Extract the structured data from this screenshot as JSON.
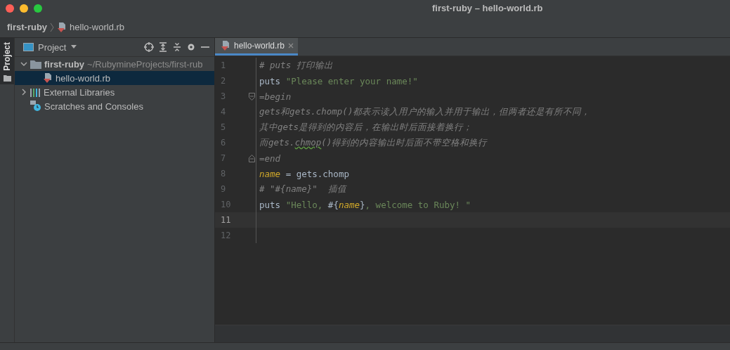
{
  "window": {
    "title": "first-ruby – hello-world.rb"
  },
  "breadcrumb": [
    {
      "label": "first-ruby",
      "kind": "project"
    },
    {
      "label": "hello-world.rb",
      "kind": "ruby"
    }
  ],
  "side_strip": {
    "tab": {
      "label": "Project",
      "selected": true
    }
  },
  "project_panel": {
    "title": "Project",
    "tree": [
      {
        "label": "first-ruby",
        "note": "~/RubymineProjects/first-rub",
        "kind": "folder",
        "expanded": true,
        "selected": false,
        "children": [
          {
            "label": "hello-world.rb",
            "kind": "ruby",
            "selected": true
          }
        ]
      },
      {
        "label": "External Libraries",
        "kind": "library",
        "expanded": false,
        "selected": false
      },
      {
        "label": "Scratches and Consoles",
        "kind": "scratch",
        "selected": false
      }
    ]
  },
  "editor": {
    "tabs": [
      {
        "label": "hello-world.rb",
        "selected": true
      }
    ],
    "lines": [
      {
        "number": "1",
        "current": false,
        "tokens": [
          {
            "kind": "comment",
            "text": "# puts 打印输出"
          }
        ]
      },
      {
        "number": "2",
        "current": false,
        "tokens": [
          {
            "kind": "plain",
            "text": "puts "
          },
          {
            "kind": "string",
            "text": "\"Please enter your name!\""
          }
        ]
      },
      {
        "number": "3",
        "current": false,
        "fold_start": true,
        "tokens": [
          {
            "kind": "doc",
            "text": "=begin"
          }
        ]
      },
      {
        "number": "4",
        "current": false,
        "tokens": [
          {
            "kind": "doc",
            "text": "gets和gets.chomp()都表示读入用户的输入并用于输出，但两者还是有所不同，"
          }
        ]
      },
      {
        "number": "5",
        "current": false,
        "tokens": [
          {
            "kind": "doc",
            "text": "其中gets是得到的内容后，在输出时后面接着换行；"
          }
        ]
      },
      {
        "number": "6",
        "current": false,
        "tokens": [
          {
            "kind": "doc",
            "text": "而gets."
          },
          {
            "kind": "typo",
            "text": "chmop"
          },
          {
            "kind": "doc",
            "text": "()得到的内容输出时后面不带空格和换行"
          }
        ]
      },
      {
        "number": "7",
        "current": false,
        "fold_end": true,
        "tokens": [
          {
            "kind": "doc",
            "text": "=end"
          }
        ]
      },
      {
        "number": "8",
        "current": false,
        "tokens": [
          {
            "kind": "variable",
            "text": "name"
          },
          {
            "kind": "plain",
            "text": " = gets.chomp"
          }
        ]
      },
      {
        "number": "9",
        "current": false,
        "tokens": [
          {
            "kind": "comment",
            "text": "# \"#{name}\"  插值"
          }
        ]
      },
      {
        "number": "10",
        "current": false,
        "tokens": [
          {
            "kind": "plain",
            "text": "puts "
          },
          {
            "kind": "string",
            "text": "\"Hello, "
          },
          {
            "kind": "plain",
            "text": "#{"
          },
          {
            "kind": "variable",
            "text": "name"
          },
          {
            "kind": "plain",
            "text": "}"
          },
          {
            "kind": "string",
            "text": ", welcome to Ruby! \""
          }
        ]
      },
      {
        "number": "11",
        "current": true
      },
      {
        "number": "12",
        "current": false
      }
    ]
  }
}
